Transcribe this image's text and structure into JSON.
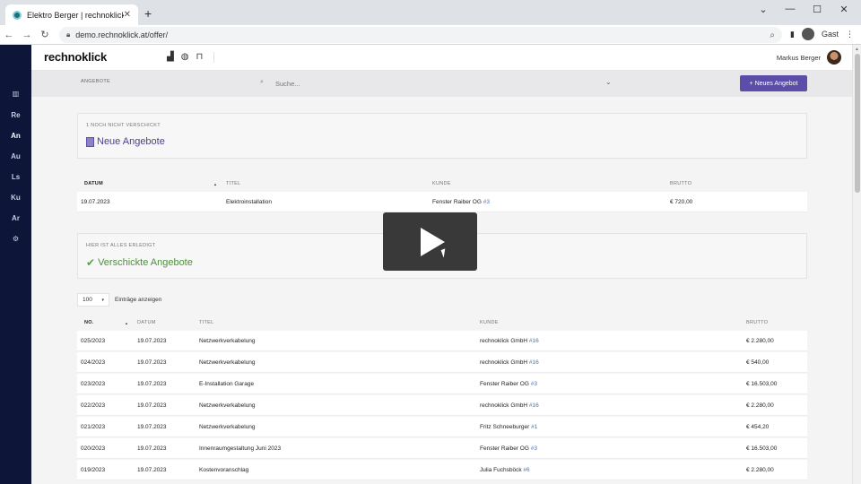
{
  "browser": {
    "tab_title": "Elektro Berger | rechnoklick",
    "tab_close": "✕",
    "new_tab": "+",
    "url": "demo.rechnoklick.at/offer/",
    "profile": "Gast",
    "min": "⌄",
    "minimize": "—",
    "maximize": "☐",
    "close": "✕"
  },
  "app": {
    "logo": "rechnoklick",
    "user_name": "Markus Berger",
    "sidebar": [
      "Re",
      "An",
      "Au",
      "Ls",
      "Ku",
      "Ar"
    ],
    "active_sidebar": "An",
    "breadcrumb": "ANGEBOTE",
    "search_placeholder": "Suche...",
    "new_button": "Neues Angebot",
    "new_button_plus": "+"
  },
  "pending_card": {
    "kicker": "1 NOCH NICHT VERSCHICKT",
    "title": "Neue Angebote"
  },
  "pending_table": {
    "headers": [
      "DATUM",
      "TITEL",
      "KUNDE",
      "BRUTTO"
    ],
    "rows": [
      {
        "datum": "19.07.2023",
        "titel": "Elektroinstallation",
        "kunde": "Fenster Raiber OG",
        "kunde_num": "#3",
        "brutto": "€ 720,00"
      }
    ]
  },
  "sent_card": {
    "kicker": "HIER IST ALLES ERLEDIGT",
    "title": "Verschickte Angebote"
  },
  "entries": {
    "value": "100",
    "label": "Einträge anzeigen"
  },
  "sent_table": {
    "headers": [
      "NO.",
      "DATUM",
      "TITEL",
      "KUNDE",
      "BRUTTO"
    ],
    "rows": [
      {
        "no": "025/2023",
        "datum": "19.07.2023",
        "titel": "Netzwerkverkabelung",
        "kunde": "rechnoklick GmbH",
        "kunde_num": "#16",
        "brutto": "€ 2.280,00"
      },
      {
        "no": "024/2023",
        "datum": "19.07.2023",
        "titel": "Netzwerkverkabelung",
        "kunde": "rechnoklick GmbH",
        "kunde_num": "#16",
        "brutto": "€ 540,00"
      },
      {
        "no": "023/2023",
        "datum": "19.07.2023",
        "titel": "E-Installation Garage",
        "kunde": "Fenster Raiber OG",
        "kunde_num": "#3",
        "brutto": "€ 16.503,00"
      },
      {
        "no": "022/2023",
        "datum": "19.07.2023",
        "titel": "Netzwerkverkabelung",
        "kunde": "rechnoklick GmbH",
        "kunde_num": "#16",
        "brutto": "€ 2.280,00"
      },
      {
        "no": "021/2023",
        "datum": "19.07.2023",
        "titel": "Netzwerkverkabelung",
        "kunde": "Fritz Schneeburger",
        "kunde_num": "#1",
        "brutto": "€ 454,20"
      },
      {
        "no": "020/2023",
        "datum": "19.07.2023",
        "titel": "Innenraumgestaltung Juni 2023",
        "kunde": "Fenster Raiber OG",
        "kunde_num": "#3",
        "brutto": "€ 16.503,00"
      },
      {
        "no": "019/2023",
        "datum": "19.07.2023",
        "titel": "Kostenvoranschlag",
        "kunde": "Julia Fuchsböck",
        "kunde_num": "#6",
        "brutto": "€ 2.280,00"
      }
    ]
  }
}
